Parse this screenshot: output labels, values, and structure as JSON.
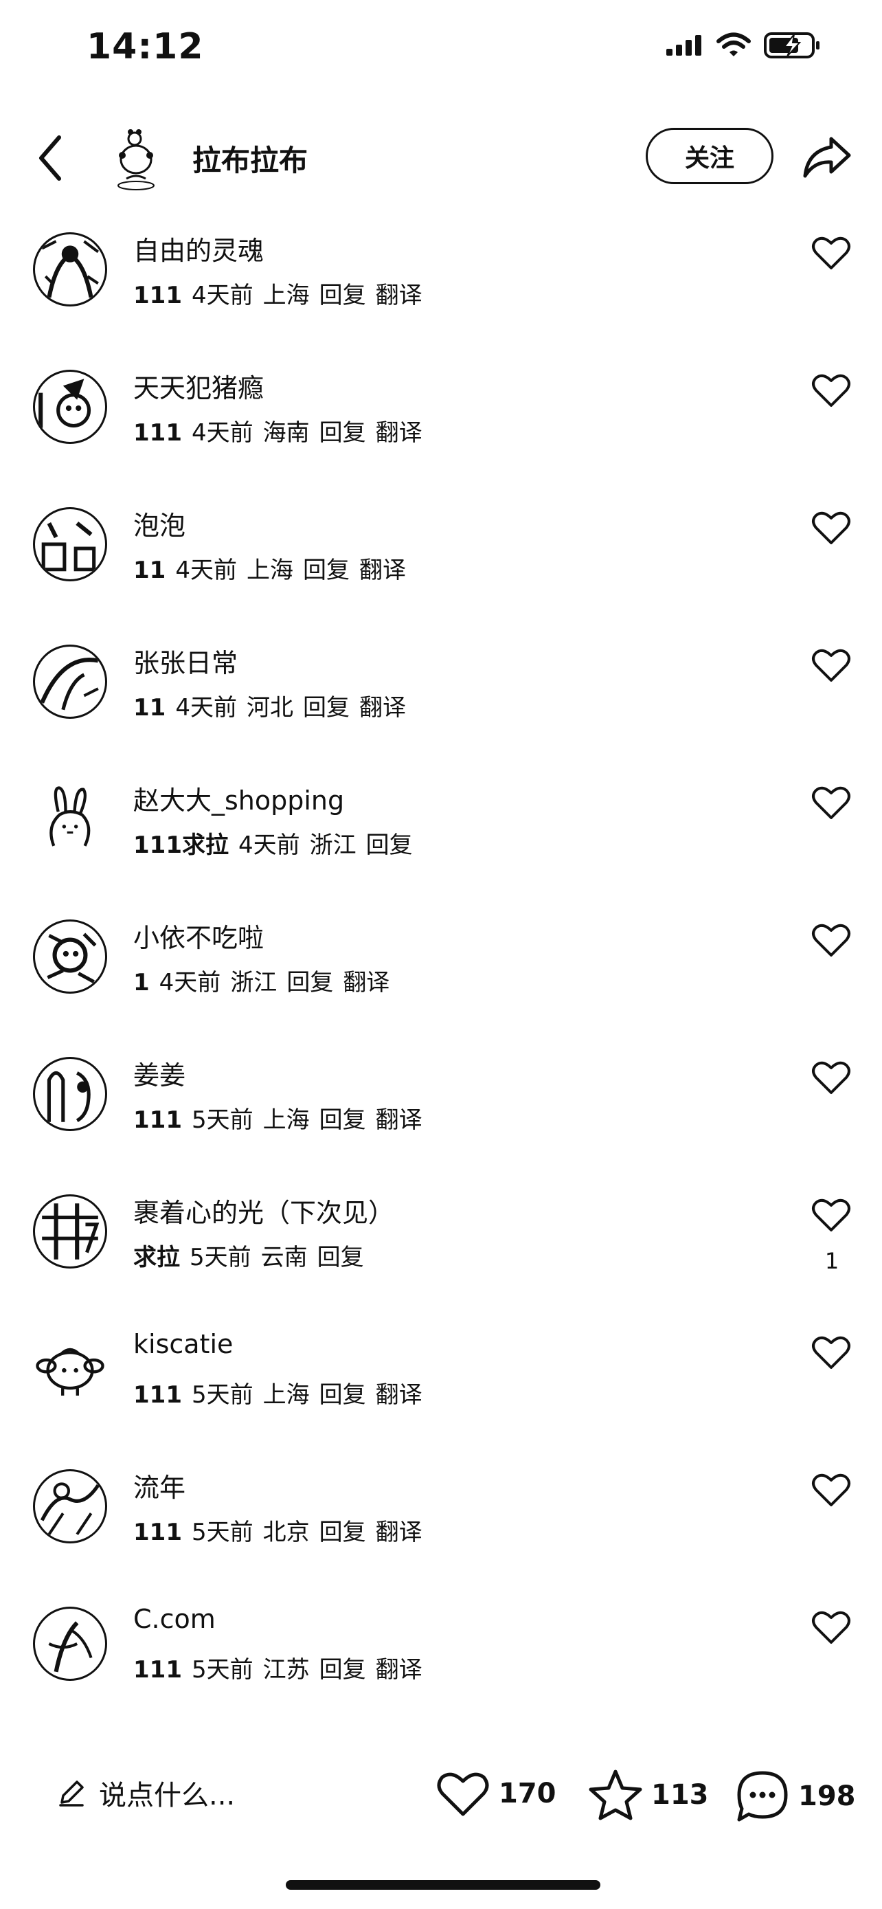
{
  "status_bar": {
    "time": "14:12"
  },
  "nav": {
    "title": "拉布拉布",
    "follow_label": "关注"
  },
  "comments": [
    {
      "name": "自由的灵魂",
      "comment": "111",
      "time": "4天前",
      "location": "上海",
      "reply": "回复",
      "translate": "翻译",
      "likes": ""
    },
    {
      "name": "天天犯猪瘾",
      "comment": "111",
      "time": "4天前",
      "location": "海南",
      "reply": "回复",
      "translate": "翻译",
      "likes": ""
    },
    {
      "name": "泡泡",
      "comment": "11",
      "time": "4天前",
      "location": "上海",
      "reply": "回复",
      "translate": "翻译",
      "likes": ""
    },
    {
      "name": "张张日常",
      "comment": "11",
      "time": "4天前",
      "location": "河北",
      "reply": "回复",
      "translate": "翻译",
      "likes": ""
    },
    {
      "name": "赵大大_shopping",
      "comment": "111求拉",
      "time": "4天前",
      "location": "浙江",
      "reply": "回复",
      "translate": "",
      "likes": ""
    },
    {
      "name": "小依不吃啦",
      "comment": "1",
      "time": "4天前",
      "location": "浙江",
      "reply": "回复",
      "translate": "翻译",
      "likes": ""
    },
    {
      "name": "姜姜",
      "comment": "111",
      "time": "5天前",
      "location": "上海",
      "reply": "回复",
      "translate": "翻译",
      "likes": ""
    },
    {
      "name": "裹着心的光（下次见）",
      "comment": "求拉",
      "time": "5天前",
      "location": "云南",
      "reply": "回复",
      "translate": "",
      "likes": "1"
    },
    {
      "name": "kiscatie",
      "comment": "111",
      "time": "5天前",
      "location": "上海",
      "reply": "回复",
      "translate": "翻译",
      "likes": ""
    },
    {
      "name": "流年",
      "comment": "111",
      "time": "5天前",
      "location": "北京",
      "reply": "回复",
      "translate": "翻译",
      "likes": ""
    },
    {
      "name": "C.com",
      "comment": "111",
      "time": "5天前",
      "location": "江苏",
      "reply": "回复",
      "translate": "翻译",
      "likes": ""
    }
  ],
  "bottom_bar": {
    "input_placeholder": "说点什么...",
    "likes": "170",
    "favorites": "113",
    "comments": "198"
  },
  "icons": {
    "back": "chevron-left-icon",
    "share": "share-arrow-icon",
    "like": "heart-outline-icon",
    "favorite": "star-outline-icon",
    "comment": "chat-bubble-icon",
    "edit": "pencil-icon"
  }
}
